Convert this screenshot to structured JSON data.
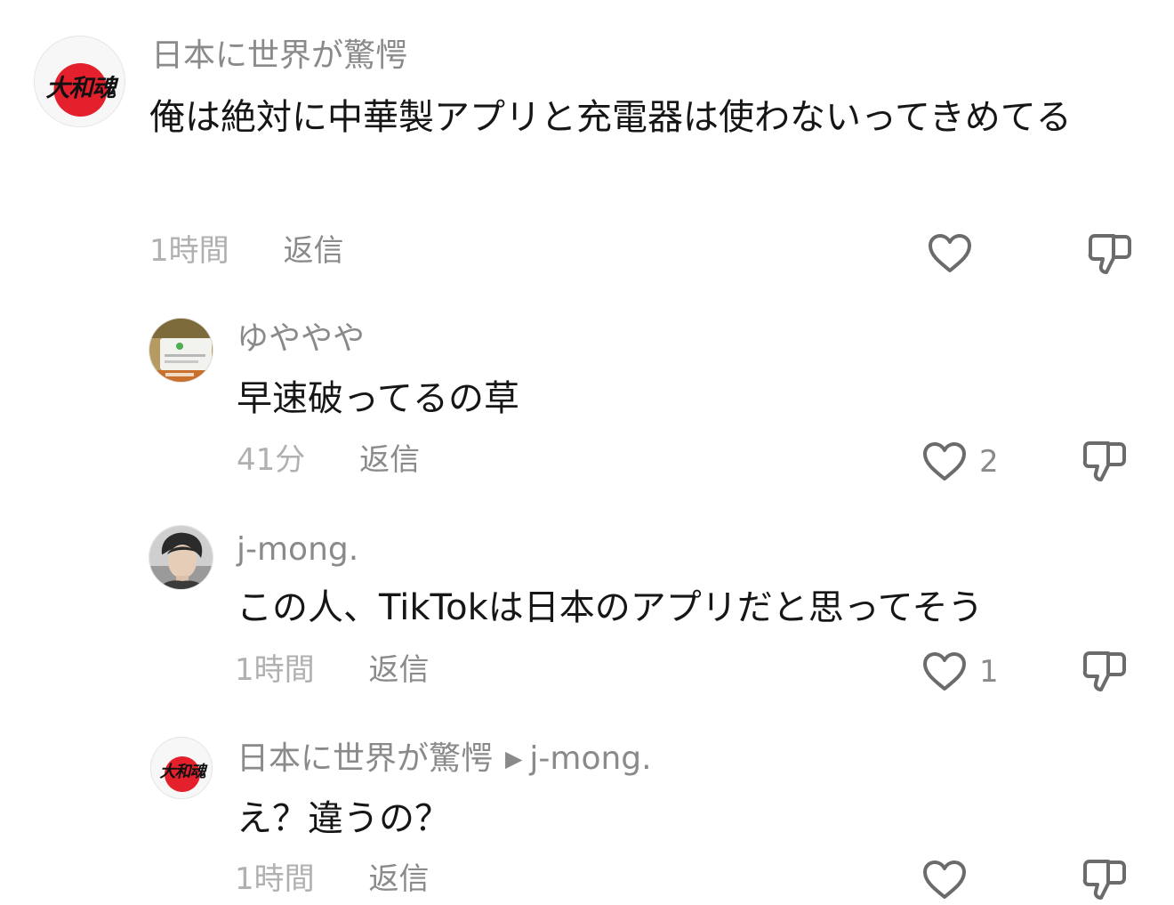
{
  "comments": [
    {
      "username": "日本に世界が驚愕",
      "avatar_icon": "yamato-damashii-flag-avatar",
      "avatar_text": "大和魂",
      "text": "俺は絶対に中華製アプリと充電器は使わないってきめてる",
      "time": "1時間",
      "reply_label": "返信",
      "likes": ""
    },
    {
      "username": "ゆややや",
      "avatar_icon": "screenshot-avatar",
      "text": "早速破ってるの草",
      "time": "41分",
      "reply_label": "返信",
      "likes": "2"
    },
    {
      "username": "j-mong.",
      "avatar_icon": "person-photo-avatar",
      "text": "この人、TikTokは日本のアプリだと思ってそう",
      "time": "1時間",
      "reply_label": "返信",
      "likes": "1"
    },
    {
      "username": "日本に世界が驚愕",
      "reply_to": "j-mong.",
      "avatar_icon": "yamato-damashii-flag-avatar",
      "avatar_text": "大和魂",
      "text": "え？違うの？",
      "time": "1時間",
      "reply_label": "返信",
      "likes": ""
    }
  ],
  "colors": {
    "text": "#161616",
    "muted": "#8a8a8a",
    "time": "#a8a8a8",
    "flag_red": "#e4202c",
    "icon_stroke": "#6b6b6b"
  }
}
